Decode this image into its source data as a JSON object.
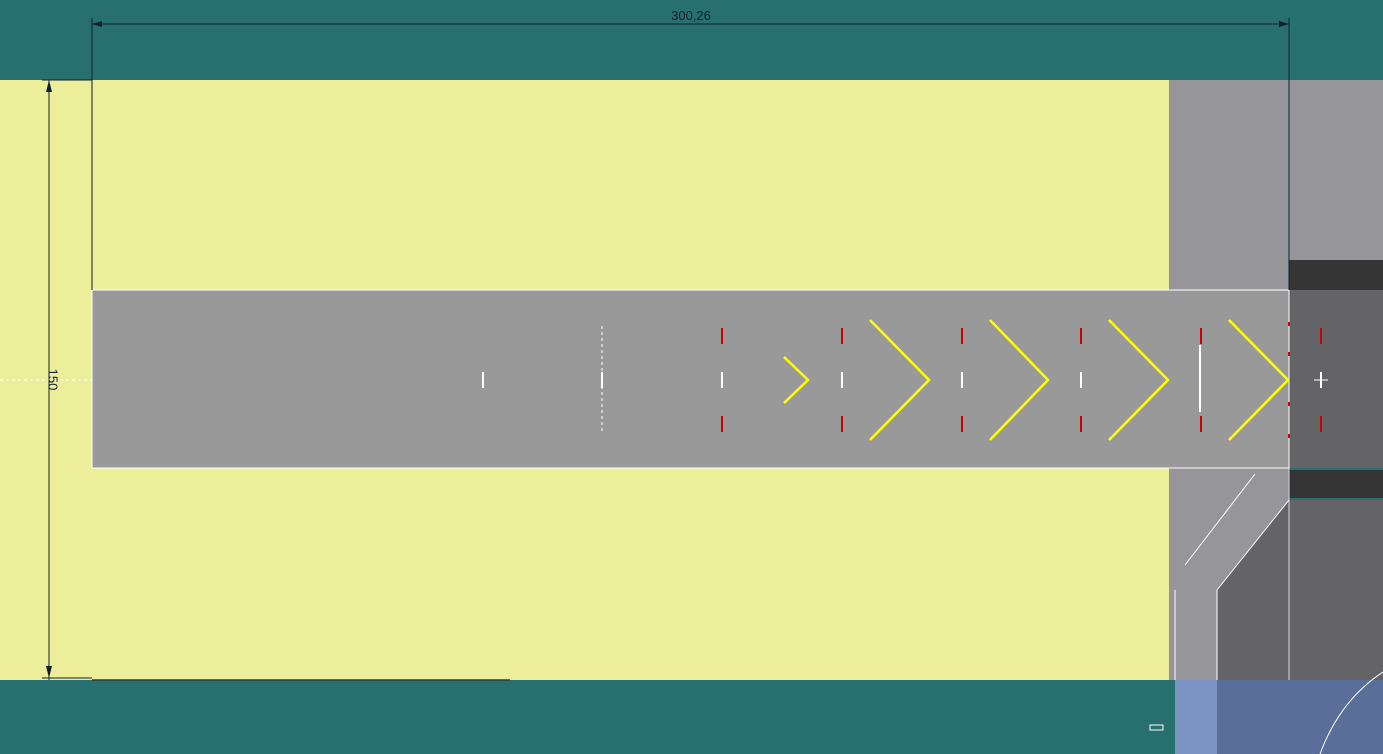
{
  "dimensions": {
    "length_label": "300,26",
    "width_label": "150"
  },
  "colors": {
    "background": "#287070",
    "grass": "#EDEE9A",
    "runway": "#999999",
    "taxiway_light": "#96969A",
    "taxiway_dark": "#646466",
    "shoulder_dark": "#353535",
    "chevron": "#FFFF00",
    "red_marking": "#CC0000",
    "white_marking": "#FFFFFF",
    "water": "#5A6E9A",
    "water_light": "#7C94C4",
    "dimension_line": "#102030"
  }
}
